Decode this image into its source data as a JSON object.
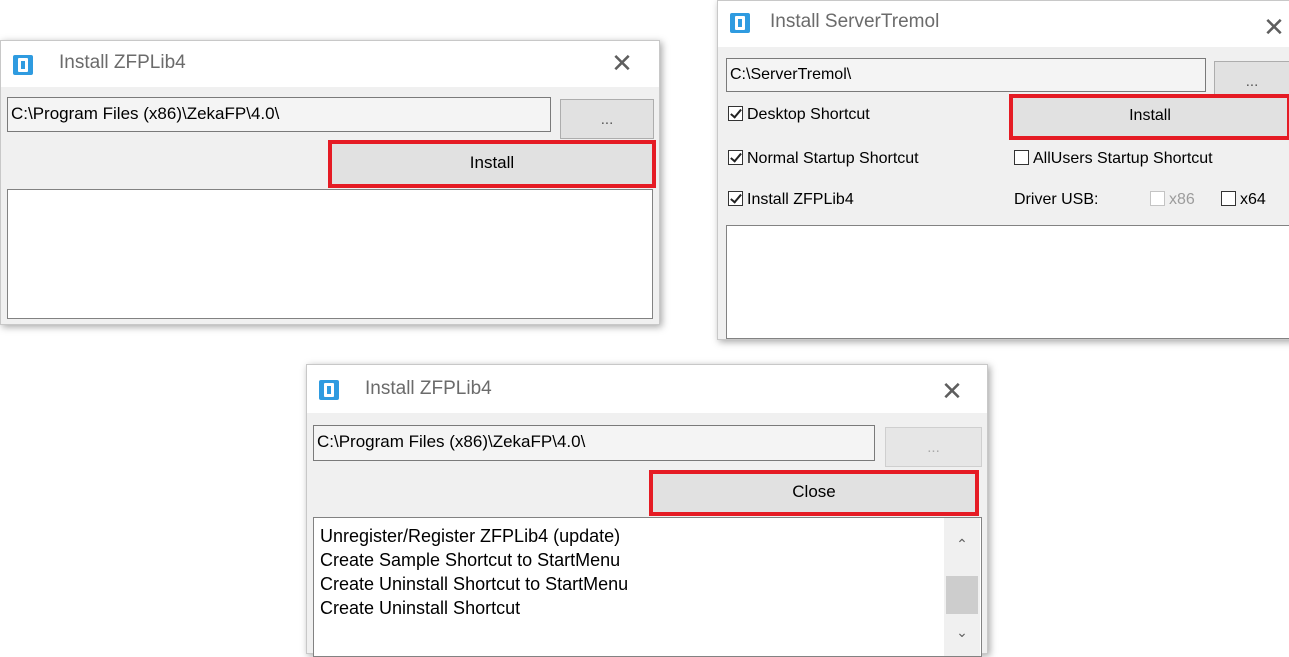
{
  "window1": {
    "title": "Install ZFPLib4",
    "path": "C:\\Program Files (x86)\\ZekaFP\\4.0\\",
    "browse_label": "...",
    "install_label": "Install"
  },
  "window2": {
    "title": "Install ServerTremol",
    "path": "C:\\ServerTremol\\",
    "browse_label": "...",
    "install_label": "Install",
    "desktop_shortcut": "Desktop Shortcut",
    "normal_startup": "Normal Startup Shortcut",
    "allusers_startup": "AllUsers Startup Shortcut",
    "install_zfplib": "Install ZFPLib4",
    "driver_usb_label": "Driver USB:",
    "x86_label": "x86",
    "x64_label": "x64"
  },
  "window3": {
    "title": "Install ZFPLib4",
    "path": "C:\\Program Files (x86)\\ZekaFP\\4.0\\",
    "browse_label": "...",
    "close_label": "Close",
    "log": [
      "Unregister/Register ZFPLib4 (update)",
      "Create Sample Shortcut to StartMenu",
      "Create Uninstall Shortcut to StartMenu",
      "Create Uninstall Shortcut"
    ]
  },
  "colors": {
    "highlight": "#e51b24",
    "icon_blue": "#2f9be0"
  }
}
